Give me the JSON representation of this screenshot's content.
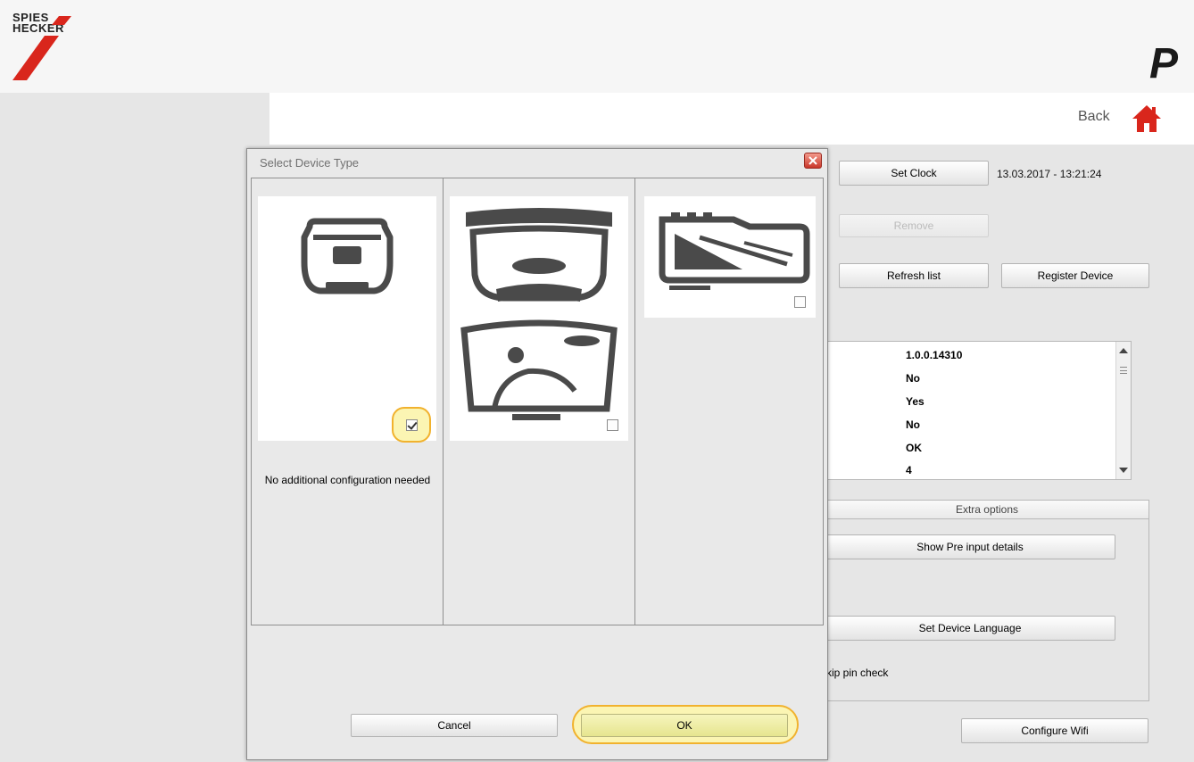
{
  "header": {
    "logo_line1": "SPIES",
    "logo_line2": "HECKER",
    "title_partial": "P",
    "brand_red": "#d9261c"
  },
  "topbar": {
    "back_label": "Back"
  },
  "device_panel": {
    "set_clock_label": "Set Clock",
    "clock_value": "13.03.2017 - 13:21:24",
    "remove_label": "Remove",
    "refresh_label": "Refresh list",
    "register_label": "Register Device",
    "info_values": [
      "1.0.0.14310",
      "No",
      "Yes",
      "No",
      "OK",
      "4"
    ],
    "extra_options_label": "Extra options",
    "show_pre_input_label": "Show Pre input details",
    "set_language_label": "Set Device Language",
    "skip_pin_text": "kip pin check",
    "configure_wifi_label": "Configure Wifi"
  },
  "dialog": {
    "title": "Select Device Type",
    "options": [
      {
        "checked": true,
        "caption": "No additional configuration needed"
      },
      {
        "checked": false,
        "caption": ""
      },
      {
        "checked": false,
        "caption": ""
      }
    ],
    "cancel_label": "Cancel",
    "ok_label": "OK",
    "highlight_color": "#f1b22e"
  }
}
